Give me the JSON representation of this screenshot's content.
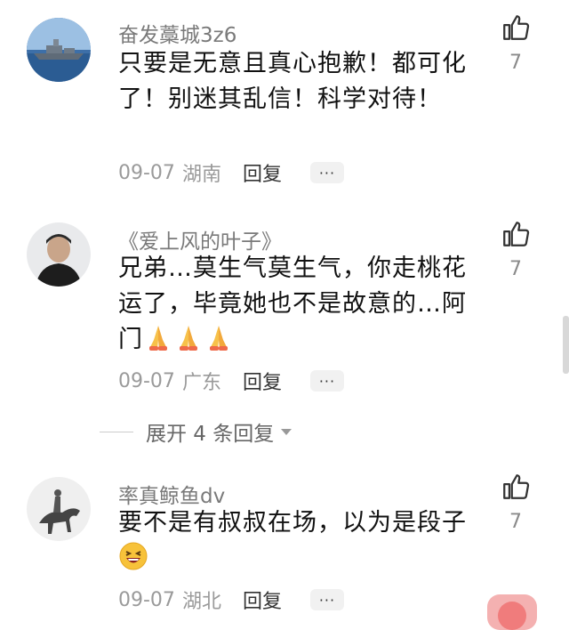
{
  "comments": [
    {
      "username": "奋发藁城3z6",
      "content": "只要是无意且真心抱歉！都可化了！别迷其乱信！科学对待！",
      "date": "09-07",
      "location": "湖南",
      "reply_label": "回复",
      "likes": "7",
      "avatar_icon": "warship-avatar"
    },
    {
      "username": "《爱上风的叶子》",
      "content": "兄弟…莫生气莫生气，你走桃花运了，毕竟她也不是故意的…阿门",
      "emoji": "folded-hands-emoji",
      "date": "09-07",
      "location": "广东",
      "reply_label": "回复",
      "likes": "7",
      "avatar_icon": "man-portrait-avatar"
    },
    {
      "username": "率真鲸鱼dv",
      "content": "要不是有叔叔在场，以为是段子",
      "emoji": "laughing-emoji",
      "date": "09-07",
      "location": "湖北",
      "reply_label": "回复",
      "likes": "7",
      "avatar_icon": "horse-rider-avatar"
    }
  ],
  "expand_replies": "展开 4 条回复",
  "more_label": "···",
  "colors": {
    "text_primary": "#111111",
    "text_secondary": "#7a7a7a",
    "meta": "#9a9a9a",
    "more_bg": "#f1f1f1",
    "accent_float": "#f07c7c"
  }
}
